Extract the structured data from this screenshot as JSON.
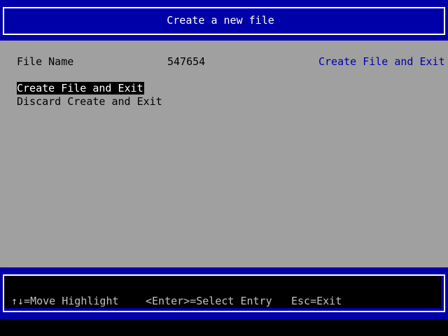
{
  "header": {
    "title": "Create a new file"
  },
  "form": {
    "file_name_label": "File Name",
    "file_name_value": "547654"
  },
  "help": {
    "text": "Create File and Exit"
  },
  "menu": {
    "items": [
      {
        "label": "Create File and Exit",
        "selected": true
      },
      {
        "label": "Discard Create and Exit",
        "selected": false
      }
    ]
  },
  "footer": {
    "move": "↑↓=Move Highlight",
    "select": "<Enter>=Select Entry",
    "exit": "Esc=Exit"
  },
  "colors": {
    "background": "#a0a0a0",
    "header_blue": "#0000a8",
    "help_text": "#0000a8",
    "highlight_bg": "#000000",
    "highlight_fg": "#ffffff"
  }
}
